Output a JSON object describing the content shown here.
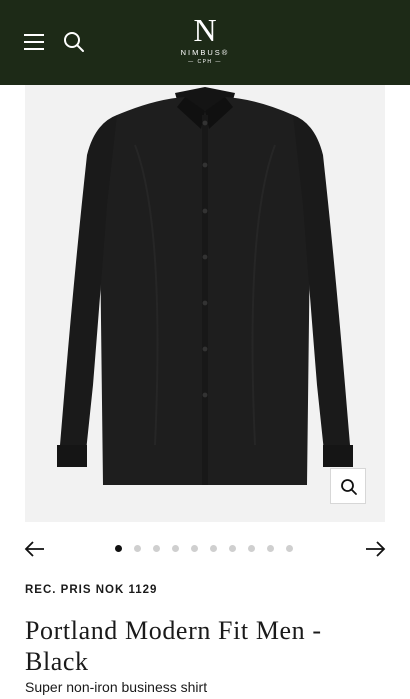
{
  "header": {
    "background": "#1d2a17",
    "menu_icon": "hamburger-menu-icon",
    "search_icon": "search-icon",
    "logo": {
      "mark": "N",
      "wordmark": "NIMBUS®",
      "sub": "— CPH —"
    }
  },
  "product_image": {
    "alt": "Black long-sleeve business shirt",
    "zoom_icon": "zoom-icon"
  },
  "carousel": {
    "prev_icon": "arrow-left-icon",
    "next_icon": "arrow-right-icon",
    "dot_count": 10,
    "active_index": 0
  },
  "product": {
    "price_label": "REC. PRIS NOK 1129",
    "title": "Portland Modern Fit Men - Black",
    "subtitle": "Super non-iron business shirt"
  }
}
